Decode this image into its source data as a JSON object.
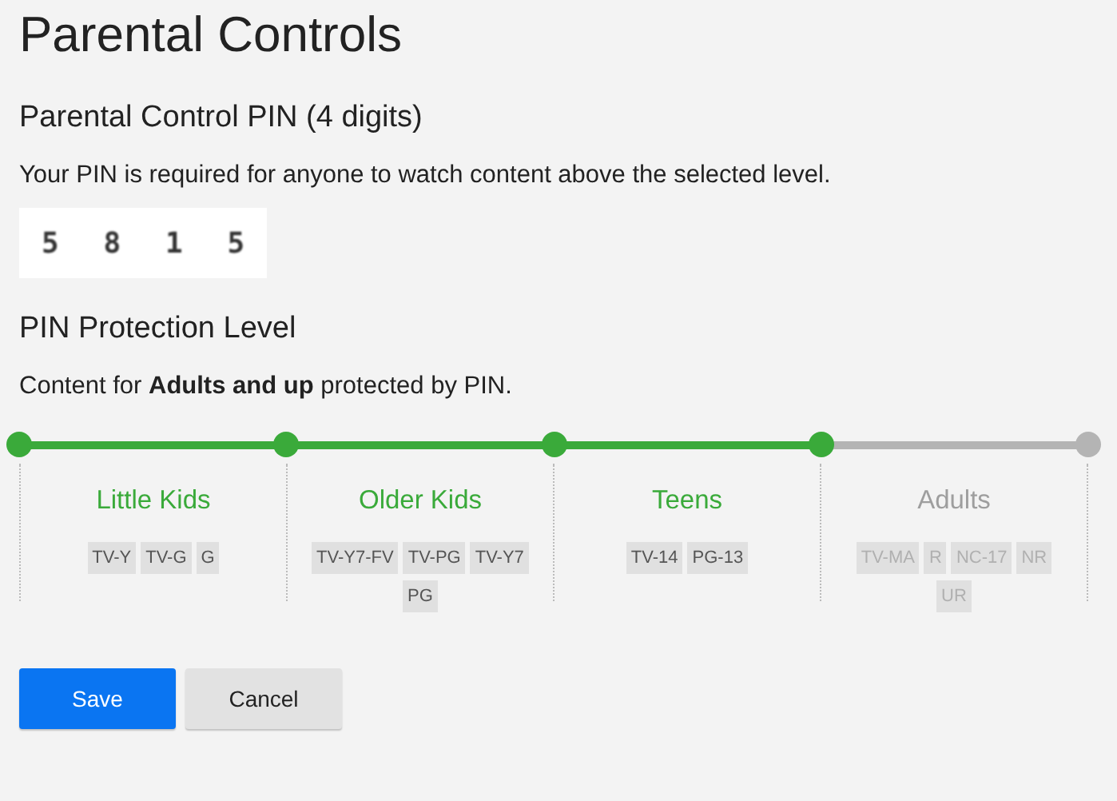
{
  "title": "Parental Controls",
  "pin_section": {
    "heading": "Parental Control PIN (4 digits)",
    "description": "Your PIN is required for anyone to watch content above the selected level.",
    "digits": [
      "5",
      "8",
      "1",
      "5"
    ]
  },
  "level_section": {
    "heading": "PIN Protection Level",
    "summary": "Content for **Adults and up** protected by PIN.",
    "levels": [
      {
        "name": "Little Kids",
        "allowed": true,
        "ratings": [
          "TV-Y",
          "TV-G",
          "G"
        ]
      },
      {
        "name": "Older Kids",
        "allowed": true,
        "ratings": [
          "TV-Y7-FV",
          "TV-PG",
          "TV-Y7",
          "PG"
        ]
      },
      {
        "name": "Teens",
        "allowed": true,
        "ratings": [
          "TV-14",
          "PG-13"
        ]
      },
      {
        "name": "Adults",
        "allowed": false,
        "ratings": [
          "TV-MA",
          "R",
          "NC-17",
          "NR",
          "UR"
        ]
      }
    ]
  },
  "buttons": [
    {
      "label": "Save",
      "kind": "primary"
    },
    {
      "label": "Cancel",
      "kind": "secondary"
    }
  ]
}
